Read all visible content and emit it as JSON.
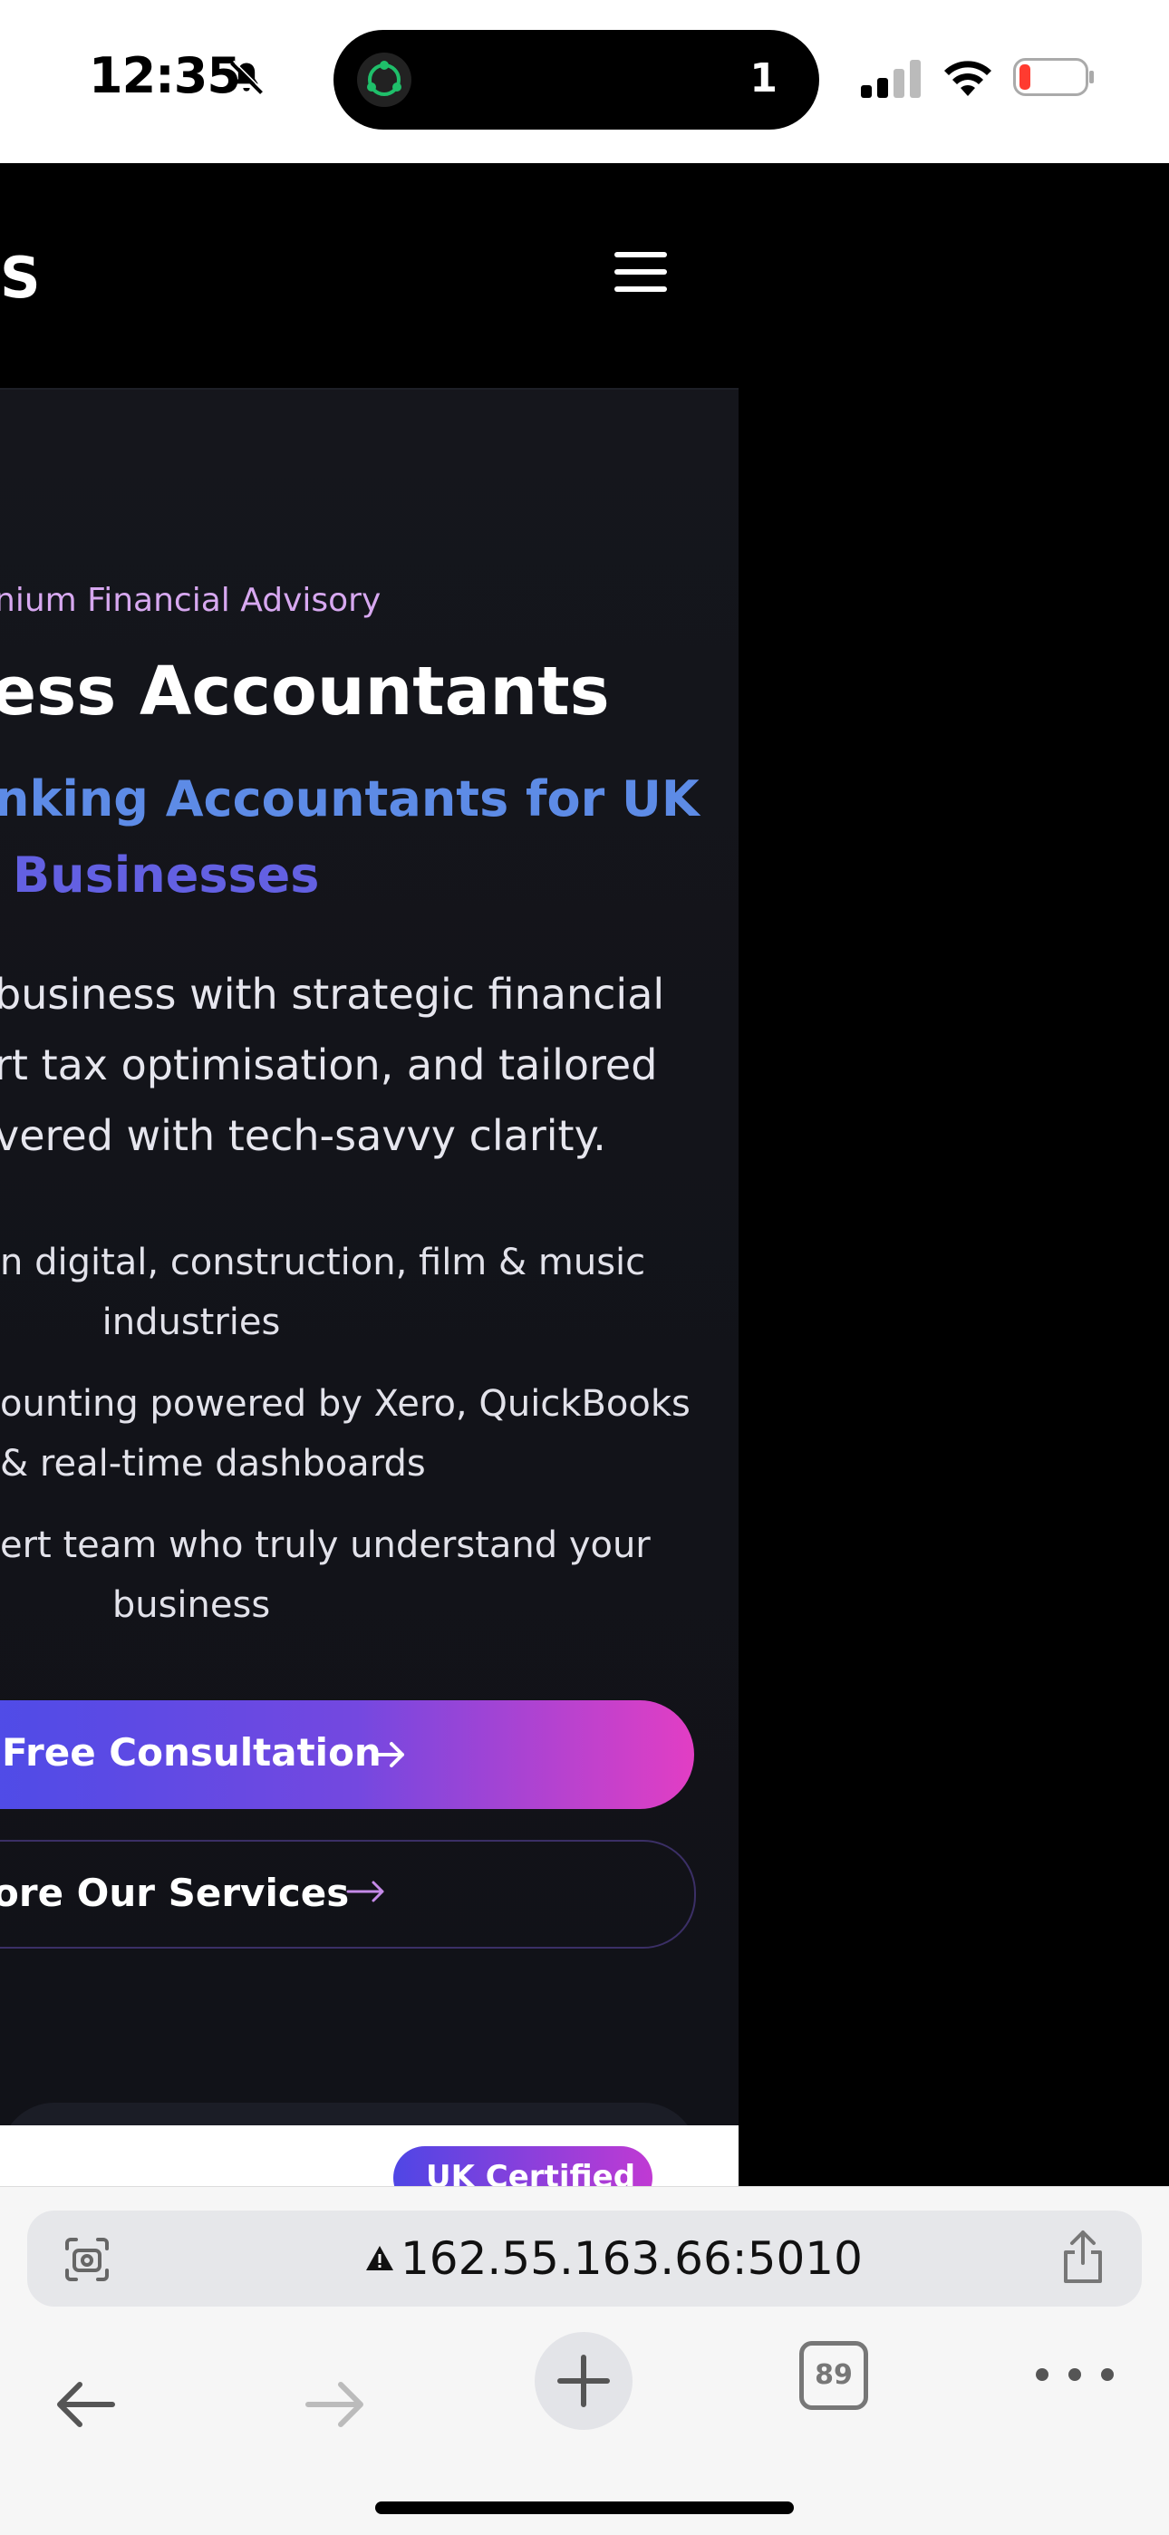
{
  "status_bar": {
    "time": "12:35",
    "island_count": "1"
  },
  "header": {
    "logo_fragment": "S"
  },
  "hero": {
    "eyebrow": "nium Financial Advisory",
    "title": "ess Accountants",
    "subtitle_line1": "nking Accountants for UK",
    "subtitle_line2": "Businesses",
    "lead_lines": [
      "business with strategic financial",
      "rt tax optimisation, and tailored",
      "vered with tech-savvy clarity."
    ],
    "bullets": [
      {
        "line1": "n digital, construction, film & music",
        "line2": "industries"
      },
      {
        "line1": "ounting powered by Xero, QuickBooks",
        "line2": "& real-time dashboards"
      },
      {
        "line1": "ert team who truly understand your",
        "line2": "business"
      }
    ],
    "primary_cta": "Free Consultation",
    "secondary_cta": "ore Our Services",
    "badge": "UK Certified"
  },
  "browser": {
    "url": "162.55.163.66:5010",
    "tab_count": "89"
  },
  "colors": {
    "accent_start": "#4a4ce8",
    "accent_end": "#e23ec4",
    "eyebrow": "#d7a8f0",
    "subtitle": "#6360e2"
  }
}
